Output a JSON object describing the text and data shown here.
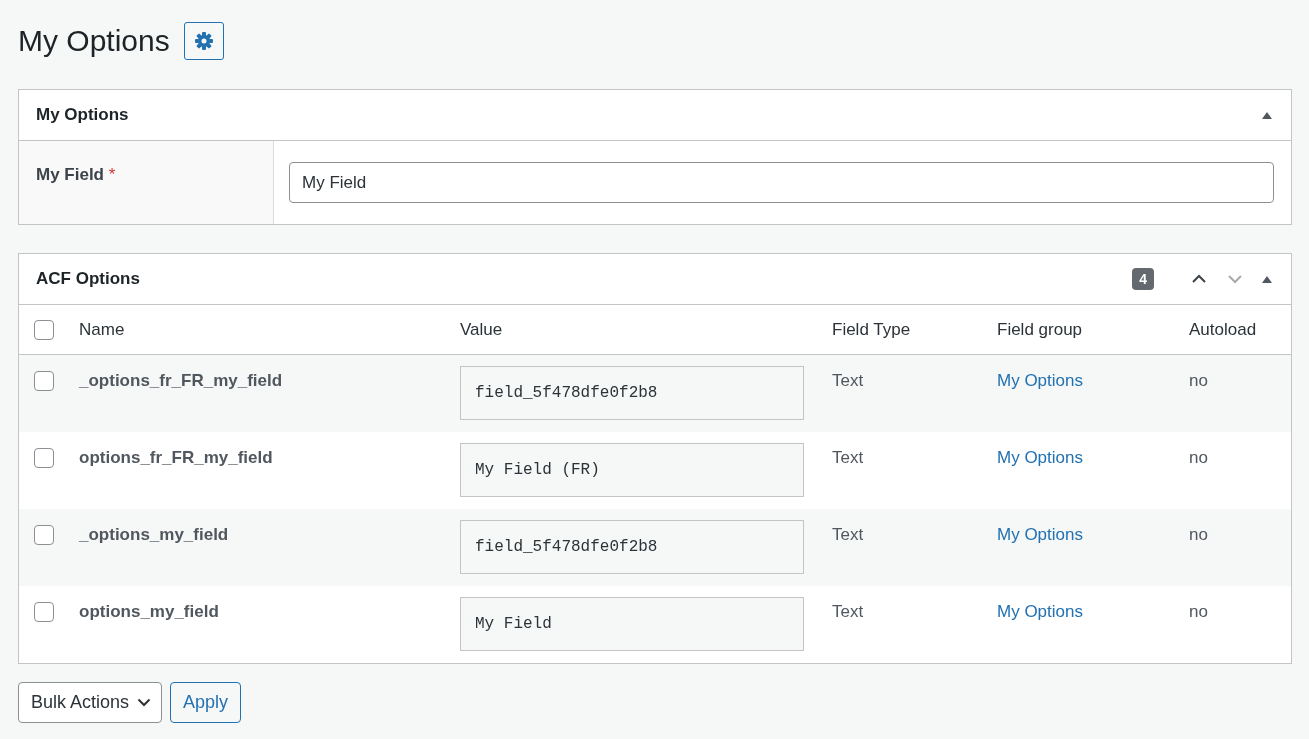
{
  "page_title": "My Options",
  "fields_panel": {
    "title": "My Options",
    "expanded": true,
    "fields": [
      {
        "label": "My Field",
        "required_mark": "*",
        "value": "My Field"
      }
    ]
  },
  "options_panel": {
    "title": "ACF Options",
    "count": "4",
    "expanded": true,
    "columns": [
      "Name",
      "Value",
      "Field Type",
      "Field group",
      "Autoload"
    ],
    "select_all": {
      "checked": false
    },
    "rows": [
      {
        "checked": false,
        "name": "_options_fr_FR_my_field",
        "value": "field_5f478dfe0f2b8",
        "type": "Text",
        "group": "My Options",
        "autoload": "no"
      },
      {
        "checked": false,
        "name": "options_fr_FR_my_field",
        "value": "My Field (FR)",
        "type": "Text",
        "group": "My Options",
        "autoload": "no"
      },
      {
        "checked": false,
        "name": "_options_my_field",
        "value": "field_5f478dfe0f2b8",
        "type": "Text",
        "group": "My Options",
        "autoload": "no"
      },
      {
        "checked": false,
        "name": "options_my_field",
        "value": "My Field",
        "type": "Text",
        "group": "My Options",
        "autoload": "no"
      }
    ]
  },
  "bulk_actions": {
    "select": "Bulk Actions",
    "apply": "Apply"
  }
}
